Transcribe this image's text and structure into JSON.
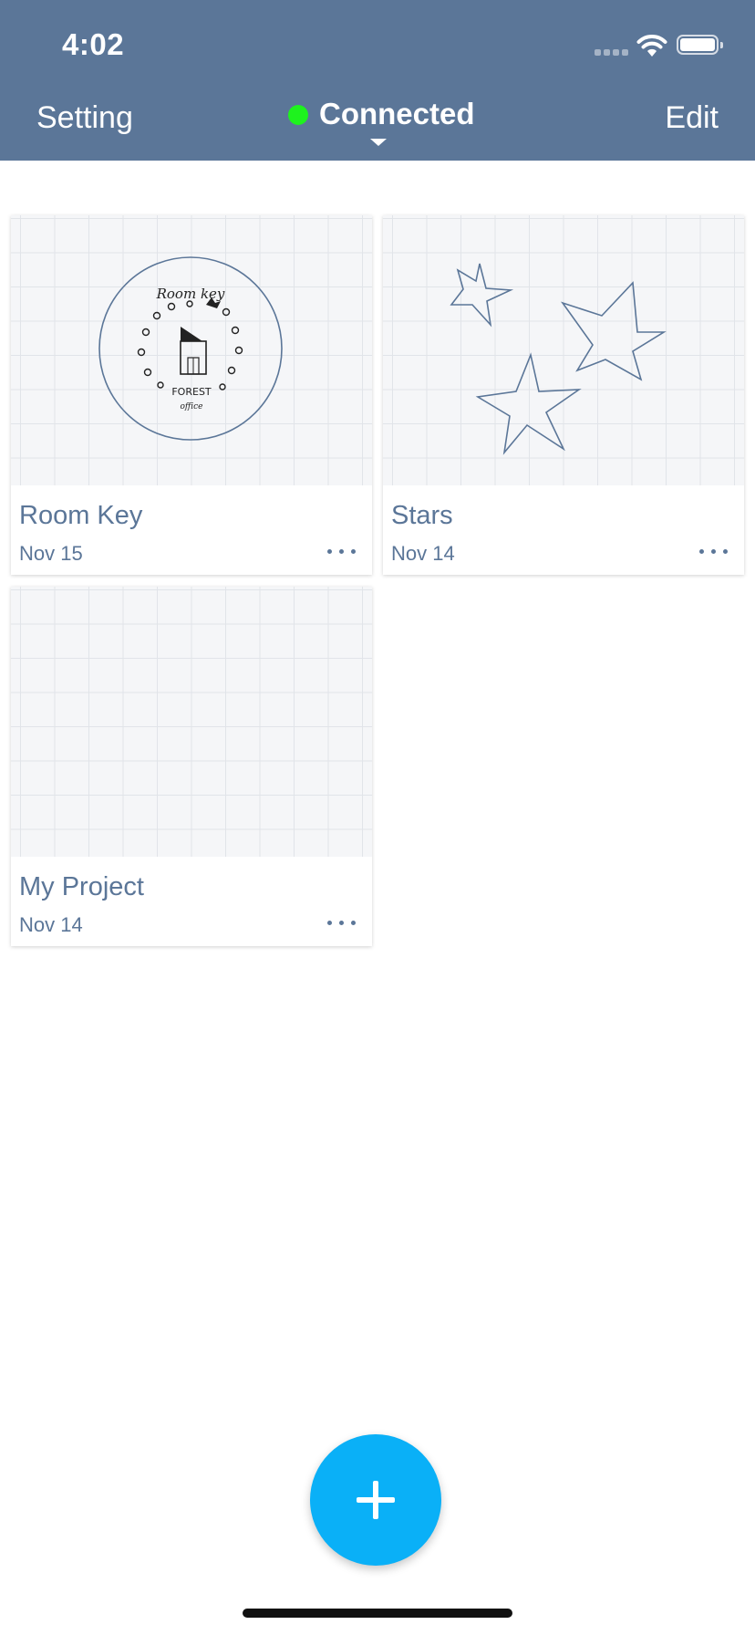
{
  "status_bar": {
    "time": "4:02"
  },
  "nav": {
    "left_label": "Setting",
    "center_label": "Connected",
    "right_label": "Edit",
    "connection_color": "#1ef21e"
  },
  "projects": [
    {
      "title": "Room Key",
      "date": "Nov 15",
      "thumbnail": "room-key-drawing",
      "drawing_text": [
        "Room key",
        "FOREST",
        "office"
      ]
    },
    {
      "title": "Stars",
      "date": "Nov 14",
      "thumbnail": "stars-drawing"
    },
    {
      "title": "My Project",
      "date": "Nov 14",
      "thumbnail": "empty-grid"
    }
  ],
  "fab": {
    "icon": "plus-icon",
    "color": "#0ab0f7"
  },
  "colors": {
    "header": "#5b7698",
    "text_accent": "#5b7698"
  }
}
